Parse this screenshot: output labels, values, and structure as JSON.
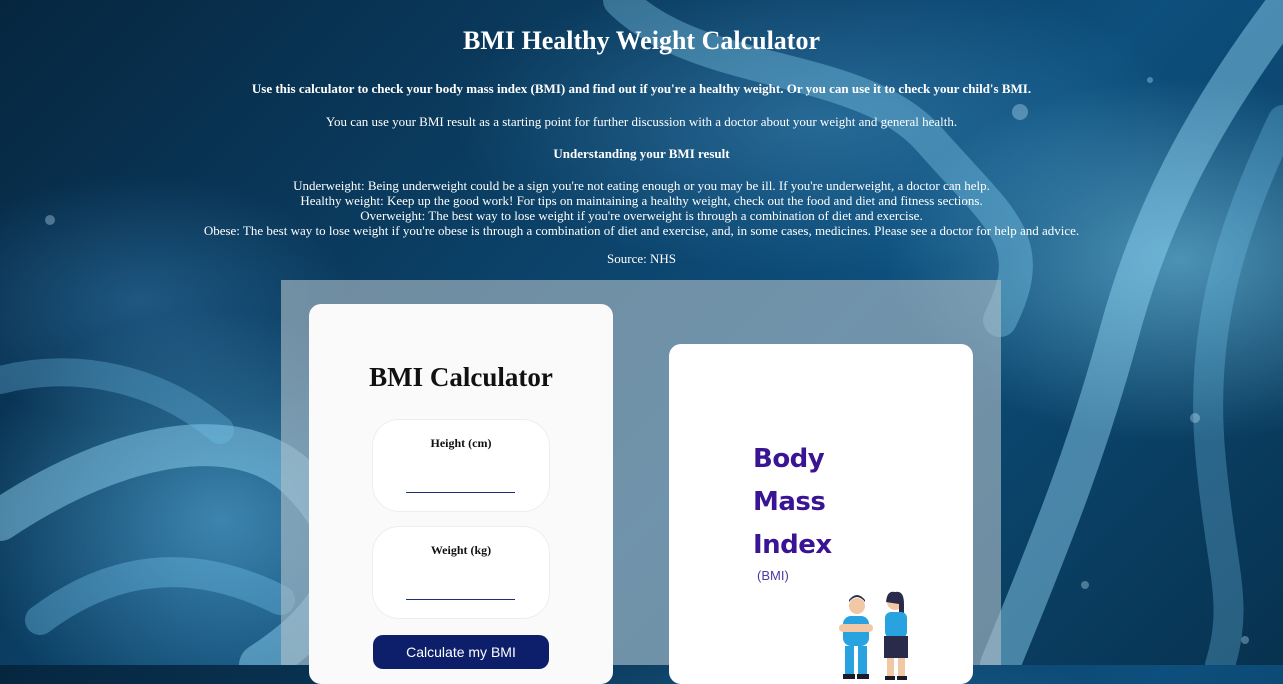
{
  "header": {
    "title": "BMI Healthy Weight Calculator",
    "intro": "Use this calculator to check your body mass index (BMI) and find out if you're a healthy weight. Or you can use it to check your child's BMI.",
    "discussion": "You can use your BMI result as a starting point for further discussion with a doctor about your weight and general health.",
    "understanding_heading": "Understanding your BMI result",
    "categories": [
      "Underweight: Being underweight could be a sign you're not eating enough or you may be ill. If you're underweight, a doctor can help.",
      "Healthy weight: Keep up the good work! For tips on maintaining a healthy weight, check out the food and diet and fitness sections.",
      "Overweight: The best way to lose weight if you're overweight is through a combination of diet and exercise.",
      "Obese: The best way to lose weight if you're obese is through a combination of diet and exercise, and, in some cases, medicines. Please see a doctor for help and advice."
    ],
    "source": "Source: NHS"
  },
  "calculator": {
    "title": "BMI Calculator",
    "height_label": "Height (cm)",
    "height_value": "",
    "weight_label": "Weight (kg)",
    "weight_value": "",
    "button_label": "Calculate my BMI"
  },
  "illustration": {
    "line1": "Body",
    "line2": "Mass",
    "line3": "Index",
    "abbr": "(BMI)"
  },
  "colors": {
    "button_bg": "#0d1f6b",
    "brand_text": "#3a1593",
    "input_underline": "#1c2f7a"
  }
}
